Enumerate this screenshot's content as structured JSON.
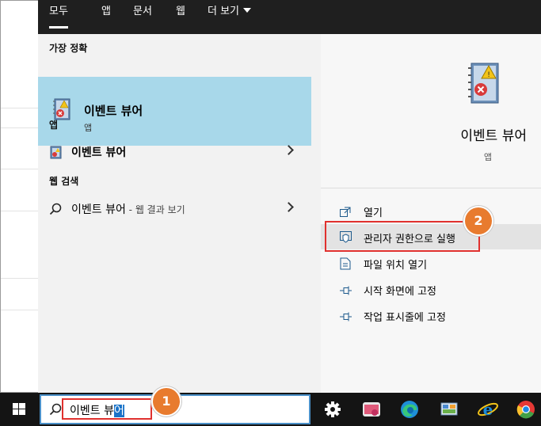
{
  "tabs": [
    {
      "label": "모두",
      "active": true
    },
    {
      "label": "앱",
      "active": false
    },
    {
      "label": "문서",
      "active": false
    },
    {
      "label": "웹",
      "active": false
    },
    {
      "label": "더 보기",
      "active": false
    }
  ],
  "left": {
    "best_match_title": "가장 정확",
    "best_match": {
      "name": "이벤트 뷰어",
      "type": "앱",
      "icon": "event-viewer-icon"
    },
    "apps_title": "앱",
    "apps": [
      {
        "name": "이벤트 뷰어",
        "icon": "event-viewer-icon"
      }
    ],
    "web_title": "웹 검색",
    "web": [
      {
        "query": "이벤트 뷰어",
        "suffix": " - 웹 결과 보기",
        "icon": "search-icon"
      }
    ]
  },
  "preview": {
    "name": "이벤트 뷰어",
    "type": "앱",
    "icon": "event-viewer-icon"
  },
  "actions": [
    {
      "label": "열기",
      "icon": "open-icon"
    },
    {
      "label": "관리자 권한으로 실행",
      "icon": "shield-icon"
    },
    {
      "label": "파일 위치 열기",
      "icon": "folder-icon"
    },
    {
      "label": "시작 화면에 고정",
      "icon": "pin-icon"
    },
    {
      "label": "작업 표시줄에 고정",
      "icon": "pin-icon"
    }
  ],
  "taskbar": {
    "search_value": "이벤트 뷰어",
    "search_value_plain": "이벤트 뷰",
    "search_value_selected": "어",
    "icons": [
      "settings-icon",
      "media-icon",
      "edge-icon",
      "control-panel-icon",
      "ie-icon",
      "chrome-icon"
    ]
  },
  "callouts": [
    {
      "label": "1"
    },
    {
      "label": "2"
    }
  ],
  "colors": {
    "highlight": "#a8d8ea",
    "callout_red": "#e0312e",
    "badge_orange": "#e87b2e",
    "taskbar": "#141414",
    "tabs_bg": "#1f1f1f"
  }
}
